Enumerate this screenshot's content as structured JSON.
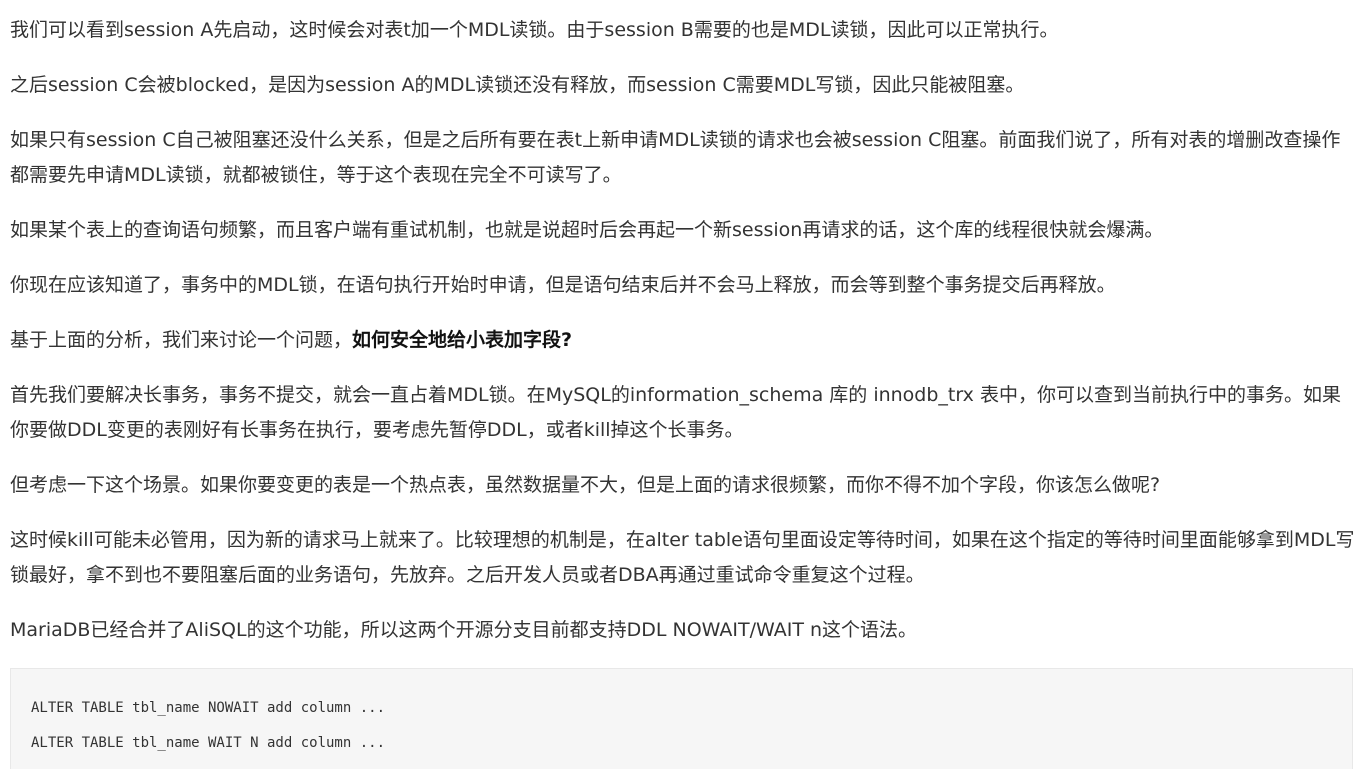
{
  "article": {
    "paragraphs": [
      "我们可以看到session A先启动，这时候会对表t加一个MDL读锁。由于session B需要的也是MDL读锁，因此可以正常执行。",
      "之后session C会被blocked，是因为session A的MDL读锁还没有释放，而session C需要MDL写锁，因此只能被阻塞。",
      "如果只有session C自己被阻塞还没什么关系，但是之后所有要在表t上新申请MDL读锁的请求也会被session C阻塞。前面我们说了，所有对表的增删改查操作都需要先申请MDL读锁，就都被锁住，等于这个表现在完全不可读写了。",
      "如果某个表上的查询语句频繁，而且客户端有重试机制，也就是说超时后会再起一个新session再请求的话，这个库的线程很快就会爆满。",
      "你现在应该知道了，事务中的MDL锁，在语句执行开始时申请，但是语句结束后并不会马上释放，而会等到整个事务提交后再释放。"
    ],
    "question_intro": "基于上面的分析，我们来讨论一个问题，",
    "question_bold": "如何安全地给小表加字段?",
    "paragraphs2": [
      "首先我们要解决长事务，事务不提交，就会一直占着MDL锁。在MySQL的information_schema 库的 innodb_trx 表中，你可以查到当前执行中的事务。如果你要做DDL变更的表刚好有长事务在执行，要考虑先暂停DDL，或者kill掉这个长事务。",
      "但考虑一下这个场景。如果你要变更的表是一个热点表，虽然数据量不大，但是上面的请求很频繁，而你不得不加个字段，你该怎么做呢?",
      "这时候kill可能未必管用，因为新的请求马上就来了。比较理想的机制是，在alter table语句里面设定等待时间，如果在这个指定的等待时间里面能够拿到MDL写锁最好，拿不到也不要阻塞后面的业务语句，先放弃。之后开发人员或者DBA再通过重试命令重复这个过程。",
      "MariaDB已经合并了AliSQL的这个功能，所以这两个开源分支目前都支持DDL NOWAIT/WAIT n这个语法。"
    ],
    "code_lines": [
      "ALTER TABLE tbl_name NOWAIT add column ...",
      "ALTER TABLE tbl_name WAIT N add column ..."
    ]
  }
}
